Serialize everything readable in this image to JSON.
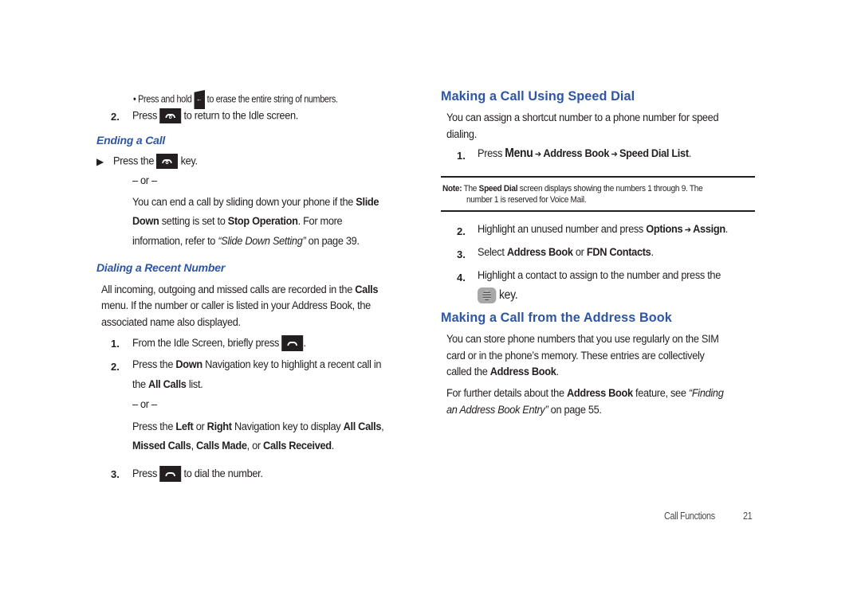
{
  "left_column": {
    "bullet_erase": {
      "pre": "Press and hold",
      "post": "to erase the entire string of numbers.",
      "icon": "clear-key-icon"
    },
    "step2_idle": {
      "number": "2.",
      "pre": "Press",
      "post": "to return to the Idle screen.",
      "icon": "end-key-icon"
    },
    "ending_heading": "Ending a Call",
    "ending_step": {
      "marker": "▶",
      "pre": "Press the",
      "post": "key.",
      "icon": "end-key-icon"
    },
    "or1": "– or –",
    "slide_para": {
      "l1_pre": "You can end a call by sliding down your phone if the ",
      "l1_b": "Slide",
      "l2_b1": "Down",
      "l2_mid": " setting is set to ",
      "l2_b2": "Stop Operation",
      "l2_post": ". For more",
      "l3_pre": "information, refer to ",
      "l3_i": "“Slide Down Setting”",
      "l3_post": "  on page 39."
    },
    "dialing_heading": "Dialing a Recent Number",
    "dialing_para": {
      "l1_pre": "All incoming, outgoing and missed calls are recorded in the ",
      "l1_b": "Calls",
      "l2": "menu. If the number or caller is listed in your Address Book, the",
      "l3": "associated name also displayed."
    },
    "step1": {
      "number": "1.",
      "pre": "From the Idle Screen, briefly press",
      "post": ".",
      "icon": "send-key-icon"
    },
    "step2": {
      "number": "2.",
      "l1_pre": "Press the ",
      "l1_b": "Down",
      "l1_post": " Navigation key to highlight a recent call in",
      "l2_pre": "the ",
      "l2_b": "All Calls",
      "l2_post": " list."
    },
    "or2": "– or –",
    "step2_alt": {
      "l1_pre": "Press the ",
      "l1_b1": "Left",
      "l1_mid": " or ",
      "l1_b2": "Right",
      "l1_mid2": " Navigation key to display ",
      "l1_b3": "All Calls",
      "l1_post": ",",
      "l2_b1": "Missed Calls",
      "l2_sep1": ", ",
      "l2_b2": "Calls Made",
      "l2_sep2": ", or ",
      "l2_b3": "Calls Received",
      "l2_post": "."
    },
    "step3": {
      "number": "3.",
      "pre": "Press",
      "post": "to dial the number.",
      "icon": "send-key-icon"
    }
  },
  "right_column": {
    "speed_heading": "Making a Call Using Speed Dial",
    "speed_para": {
      "l1": "You can assign a shortcut number to a phone number for speed",
      "l2": "dialing."
    },
    "speed_step1": {
      "number": "1.",
      "pre": "Press ",
      "b1": "Menu",
      "arrow": " ➔ ",
      "b2": "Address Book",
      "arrow2": " ➔ ",
      "b3": "Speed Dial List",
      "post": "."
    },
    "note": {
      "label": "Note:",
      "l1_pre": " The ",
      "l1_b": "Speed Dial",
      "l1_post": " screen displays showing the numbers 1 through 9. The",
      "l2": "number 1 is reserved for Voice Mail."
    },
    "speed_step2": {
      "number": "2.",
      "pre": "Highlight an unused number and press ",
      "b1": "Options",
      "arrow": " ➔ ",
      "b2": "Assign",
      "post": "."
    },
    "speed_step3": {
      "number": "3.",
      "pre": "Select ",
      "b1": "Address Book",
      "mid": " or ",
      "b2": "FDN Contacts",
      "post": "."
    },
    "speed_step4": {
      "number": "4.",
      "l1": "Highlight a contact to assign to the number and press the",
      "l2_post": "key.",
      "icon": "ok-key-icon"
    },
    "address_heading": "Making a Call from the Address Book",
    "address_para1": {
      "l1": "You can store phone numbers that you use regularly on the SIM",
      "l2": "card or in the phone’s memory. These entries are collectively",
      "l3_pre": "called the ",
      "l3_b": "Address Book",
      "l3_post": "."
    },
    "address_para2": {
      "l1_pre": "For further details about the ",
      "l1_b": "Address Book",
      "l1_mid": " feature, see ",
      "l1_i": "“Finding",
      "l2_i": "an Address Book Entry”",
      "l2_post": " on page 55."
    }
  },
  "footer": {
    "section": "Call Functions",
    "page": "21"
  },
  "colors": {
    "heading": "#2e56a3",
    "text": "#231f20"
  }
}
